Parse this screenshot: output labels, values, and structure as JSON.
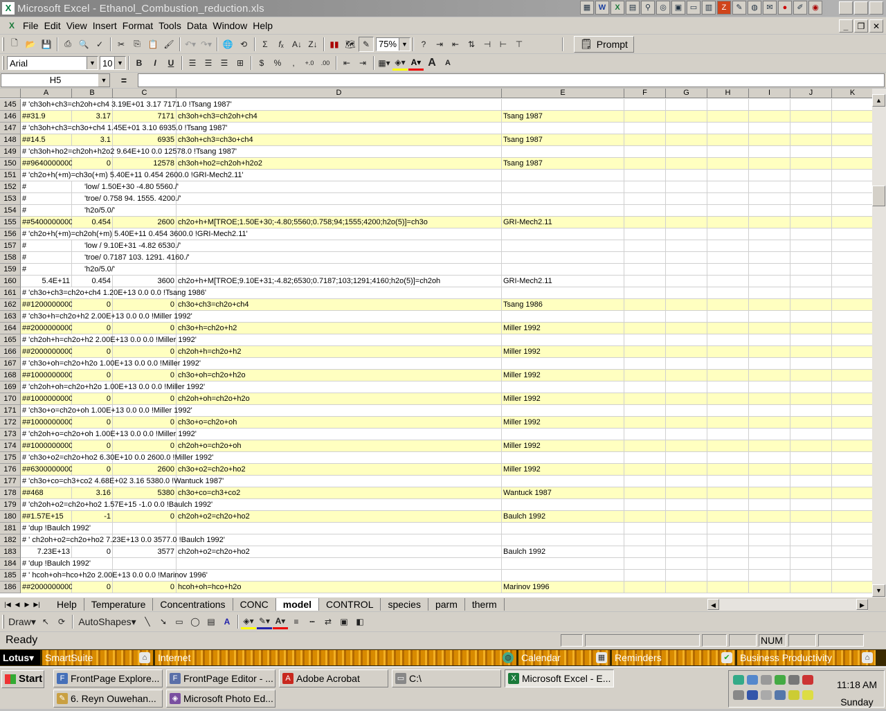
{
  "window": {
    "title": "Microsoft Excel - Ethanol_Combustion_reduction.xls",
    "app_icon": "X"
  },
  "menu": [
    "File",
    "Edit",
    "View",
    "Insert",
    "Format",
    "Tools",
    "Data",
    "Window",
    "Help"
  ],
  "toolbar": {
    "zoom": "75%",
    "prompt_label": "Prompt",
    "font_name": "Arial",
    "font_size": "10"
  },
  "formula_bar": {
    "name_box": "H5",
    "equals": "=",
    "content": ""
  },
  "columns": [
    "A",
    "B",
    "C",
    "D",
    "E",
    "F",
    "G",
    "H",
    "I",
    "J",
    "K"
  ],
  "rows": [
    {
      "n": "145",
      "hl": false,
      "a": " # 'ch3oh+ch3=ch2oh+ch4 3.19E+01 3.17 7171.0 !Tsang 1987'",
      "b": "",
      "c": "",
      "d": "",
      "e": ""
    },
    {
      "n": "146",
      "hl": true,
      "a": "##31.9",
      "b": "3.17",
      "c": "7171",
      "d": "ch3oh+ch3=ch2oh+ch4",
      "e": "Tsang 1987"
    },
    {
      "n": "147",
      "hl": false,
      "a": " # 'ch3oh+ch3=ch3o+ch4 1.45E+01 3.10 6935.0 !Tsang 1987'",
      "b": "",
      "c": "",
      "d": "",
      "e": ""
    },
    {
      "n": "148",
      "hl": true,
      "a": "##14.5",
      "b": "3.1",
      "c": "6935",
      "d": "ch3oh+ch3=ch3o+ch4",
      "e": "Tsang 1987"
    },
    {
      "n": "149",
      "hl": false,
      "a": " # 'ch3oh+ho2=ch2oh+h2o2 9.64E+10 0.0 12578.0 !Tsang 1987'",
      "b": "",
      "c": "",
      "d": "",
      "e": ""
    },
    {
      "n": "150",
      "hl": true,
      "a": "##9640000000",
      "b": "0",
      "c": "12578",
      "d": "ch3oh+ho2=ch2oh+h2o2",
      "e": "Tsang 1987"
    },
    {
      "n": "151",
      "hl": false,
      "a": " # 'ch2o+h(+m)=ch3o(+m) 5.40E+11 0.454 2600.0 !GRI-Mech2.11'",
      "b": "",
      "c": "",
      "d": "",
      "e": ""
    },
    {
      "n": "152",
      "hl": false,
      "a": " #",
      "b": "'low/ 1.50E+30 -4.80 5560./'",
      "c": "",
      "d": "",
      "e": ""
    },
    {
      "n": "153",
      "hl": false,
      "a": " #",
      "b": "'troe/ 0.758 94. 1555. 4200./'",
      "c": "",
      "d": "",
      "e": ""
    },
    {
      "n": "154",
      "hl": false,
      "a": " #",
      "b": "'h2o/5.0/'",
      "c": "",
      "d": "",
      "e": ""
    },
    {
      "n": "155",
      "hl": true,
      "a": "##5400000000",
      "b": "0.454",
      "c": "2600",
      "d": "ch2o+h+M[TROE;1.50E+30;-4.80;5560;0.758;94;1555;4200;h2o(5)]=ch3o",
      "e": "GRI-Mech2.11"
    },
    {
      "n": "156",
      "hl": false,
      "a": " # 'ch2o+h(+m)=ch2oh(+m) 5.40E+11 0.454 3600.0 !GRI-Mech2.11'",
      "b": "",
      "c": "",
      "d": "",
      "e": ""
    },
    {
      "n": "157",
      "hl": false,
      "a": " #",
      "b": "'low / 9.10E+31 -4.82 6530./'",
      "c": "",
      "d": "",
      "e": ""
    },
    {
      "n": "158",
      "hl": false,
      "a": " #",
      "b": "'troe/ 0.7187 103. 1291. 4160./'",
      "c": "",
      "d": "",
      "e": ""
    },
    {
      "n": "159",
      "hl": false,
      "a": " #",
      "b": "'h2o/5.0/'",
      "c": "",
      "d": "",
      "e": ""
    },
    {
      "n": "160",
      "hl": false,
      "a": "5.4E+11",
      "b": "0.454",
      "c": "3600",
      "d": "ch2o+h+M[TROE;9.10E+31;-4.82;6530;0.7187;103;1291;4160;h2o(5)]=ch2oh",
      "e": "GRI-Mech2.11",
      "anum": true
    },
    {
      "n": "161",
      "hl": false,
      "a": " # 'ch3o+ch3=ch2o+ch4 1.20E+13 0.0 0.0 !Tsang 1986'",
      "b": "",
      "c": "",
      "d": "",
      "e": ""
    },
    {
      "n": "162",
      "hl": true,
      "a": "##1200000000",
      "b": "0",
      "c": "0",
      "d": "ch3o+ch3=ch2o+ch4",
      "e": "Tsang 1986"
    },
    {
      "n": "163",
      "hl": false,
      "a": " # 'ch3o+h=ch2o+h2 2.00E+13 0.0 0.0 !Miller 1992'",
      "b": "",
      "c": "",
      "d": "",
      "e": ""
    },
    {
      "n": "164",
      "hl": true,
      "a": "##2000000000",
      "b": "0",
      "c": "0",
      "d": "ch3o+h=ch2o+h2",
      "e": "Miller 1992"
    },
    {
      "n": "165",
      "hl": false,
      "a": " # 'ch2oh+h=ch2o+h2 2.00E+13 0.0 0.0 !Miller 1992'",
      "b": "",
      "c": "",
      "d": "",
      "e": ""
    },
    {
      "n": "166",
      "hl": true,
      "a": "##2000000000",
      "b": "0",
      "c": "0",
      "d": "ch2oh+h=ch2o+h2",
      "e": "Miller 1992"
    },
    {
      "n": "167",
      "hl": false,
      "a": " # 'ch3o+oh=ch2o+h2o 1.00E+13 0.0 0.0 !Miller 1992'",
      "b": "",
      "c": "",
      "d": "",
      "e": ""
    },
    {
      "n": "168",
      "hl": true,
      "a": "##1000000000",
      "b": "0",
      "c": "0",
      "d": "ch3o+oh=ch2o+h2o",
      "e": "Miller 1992"
    },
    {
      "n": "169",
      "hl": false,
      "a": " # 'ch2oh+oh=ch2o+h2o 1.00E+13 0.0 0.0 !Miller 1992'",
      "b": "",
      "c": "",
      "d": "",
      "e": ""
    },
    {
      "n": "170",
      "hl": true,
      "a": "##1000000000",
      "b": "0",
      "c": "0",
      "d": "ch2oh+oh=ch2o+h2o",
      "e": "Miller 1992"
    },
    {
      "n": "171",
      "hl": false,
      "a": " # 'ch3o+o=ch2o+oh 1.00E+13 0.0 0.0 !Miller 1992'",
      "b": "",
      "c": "",
      "d": "",
      "e": ""
    },
    {
      "n": "172",
      "hl": true,
      "a": "##1000000000",
      "b": "0",
      "c": "0",
      "d": "ch3o+o=ch2o+oh",
      "e": "Miller 1992"
    },
    {
      "n": "173",
      "hl": false,
      "a": " # 'ch2oh+o=ch2o+oh 1.00E+13 0.0 0.0 !Miller 1992'",
      "b": "",
      "c": "",
      "d": "",
      "e": ""
    },
    {
      "n": "174",
      "hl": true,
      "a": "##1000000000",
      "b": "0",
      "c": "0",
      "d": "ch2oh+o=ch2o+oh",
      "e": "Miller 1992"
    },
    {
      "n": "175",
      "hl": false,
      "a": " # 'ch3o+o2=ch2o+ho2 6.30E+10 0.0 2600.0 !Miller 1992'",
      "b": "",
      "c": "",
      "d": "",
      "e": ""
    },
    {
      "n": "176",
      "hl": true,
      "a": "##6300000000",
      "b": "0",
      "c": "2600",
      "d": "ch3o+o2=ch2o+ho2",
      "e": "Miller 1992"
    },
    {
      "n": "177",
      "hl": false,
      "a": " # 'ch3o+co=ch3+co2 4.68E+02 3.16 5380.0 !Wantuck 1987'",
      "b": "",
      "c": "",
      "d": "",
      "e": ""
    },
    {
      "n": "178",
      "hl": true,
      "a": "##468",
      "b": "3.16",
      "c": "5380",
      "d": "ch3o+co=ch3+co2",
      "e": "Wantuck 1987"
    },
    {
      "n": "179",
      "hl": false,
      "a": " # 'ch2oh+o2=ch2o+ho2 1.57E+15 -1.0 0.0 !Baulch 1992'",
      "b": "",
      "c": "",
      "d": "",
      "e": ""
    },
    {
      "n": "180",
      "hl": true,
      "a": "##1.57E+15",
      "b": "-1",
      "c": "0",
      "d": "ch2oh+o2=ch2o+ho2",
      "e": "Baulch 1992"
    },
    {
      "n": "181",
      "hl": false,
      "a": " # 'dup !Baulch 1992'",
      "b": "",
      "c": "",
      "d": "",
      "e": ""
    },
    {
      "n": "182",
      "hl": false,
      "a": " # '   ch2oh+o2=ch2o+ho2       7.23E+13  0.0   3577.0   !Baulch 1992'",
      "b": "",
      "c": "",
      "d": "",
      "e": ""
    },
    {
      "n": "183",
      "hl": false,
      "a": "7.23E+13",
      "b": "0",
      "c": "3577",
      "d": "ch2oh+o2=ch2o+ho2",
      "e": "Baulch 1992",
      "anum": true
    },
    {
      "n": "184",
      "hl": false,
      "a": " # 'dup !Baulch 1992'",
      "b": "",
      "c": "",
      "d": "",
      "e": ""
    },
    {
      "n": "185",
      "hl": false,
      "a": " # '   hcoh+oh=hco+h2o          2.00E+13  0.0      0.0   !Marinov 1996'",
      "b": "",
      "c": "",
      "d": "",
      "e": ""
    },
    {
      "n": "186",
      "hl": true,
      "a": "##2000000000",
      "b": "0",
      "c": "0",
      "d": "hcoh+oh=hco+h2o",
      "e": "Marinov 1996"
    }
  ],
  "sheet_tabs": [
    "Help",
    "Temperature",
    "Concentrations",
    "CONC",
    "model",
    "CONTROL",
    "species",
    "parm",
    "therm"
  ],
  "active_tab": "model",
  "draw_toolbar": {
    "draw": "Draw",
    "autoshapes": "AutoShapes"
  },
  "status": {
    "text": "Ready",
    "num": "NUM"
  },
  "smartsuite": {
    "lotus": "Lotus",
    "drawers": [
      "SmartSuite",
      "Internet",
      "Calendar",
      "Reminders",
      "Business Productivity"
    ]
  },
  "taskbar": {
    "start": "Start",
    "tasks_row1": [
      "FrontPage Explore...",
      "FrontPage Editor - ...",
      "Adobe Acrobat",
      "C:\\",
      "Microsoft Excel - E..."
    ],
    "tasks_row2": [
      "6. Reyn Ouwehan...",
      "Microsoft Photo Ed..."
    ],
    "clock_time": "11:18 AM",
    "clock_day": "Sunday"
  }
}
